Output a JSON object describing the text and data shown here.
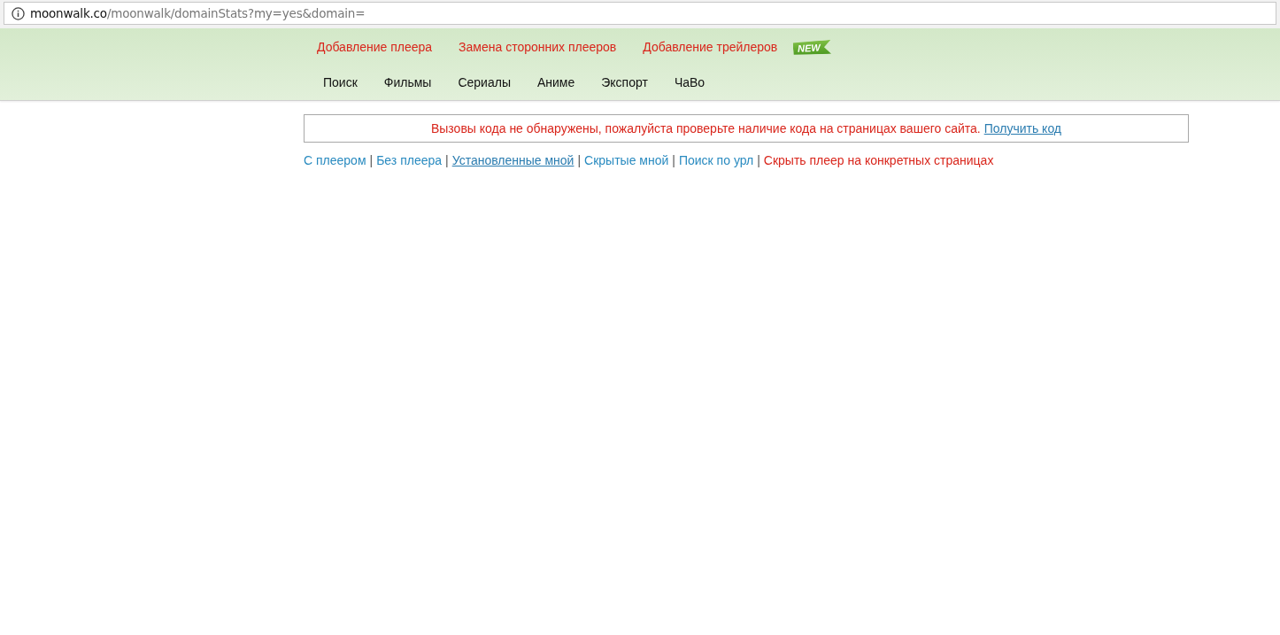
{
  "address_bar": {
    "host": "moonwalk.co",
    "path": "/moonwalk/domainStats?my=yes&domain="
  },
  "header": {
    "top_links": [
      {
        "label": "Добавление плеера"
      },
      {
        "label": "Замена сторонних плееров"
      },
      {
        "label": "Добавление трейлеров",
        "badge": "NEW"
      }
    ],
    "main_nav": [
      {
        "label": "Поиск"
      },
      {
        "label": "Фильмы"
      },
      {
        "label": "Сериалы"
      },
      {
        "label": "Аниме"
      },
      {
        "label": "Экспорт"
      },
      {
        "label": "ЧаВо"
      }
    ]
  },
  "notice": {
    "message": "Вызовы кода не обнаружены, пожалуйста проверьте наличие кода на страницах вашего сайта.",
    "link": "Получить код"
  },
  "filters": [
    {
      "label": "С плеером",
      "kind": "filter",
      "selected": false
    },
    {
      "separator": "|",
      "label": "Без плеера",
      "kind": "filter",
      "selected": false
    },
    {
      "separator": "|",
      "label": "Установленные мной",
      "kind": "filter",
      "selected": true
    },
    {
      "separator": "|",
      "label": "Скрытые мной",
      "kind": "filter",
      "selected": false
    },
    {
      "separator": "|",
      "label": "Поиск по урл",
      "kind": "filter",
      "selected": false
    },
    {
      "separator": "|",
      "label": "Скрыть плеер на конкретных страницах",
      "kind": "action",
      "selected": false
    }
  ]
}
